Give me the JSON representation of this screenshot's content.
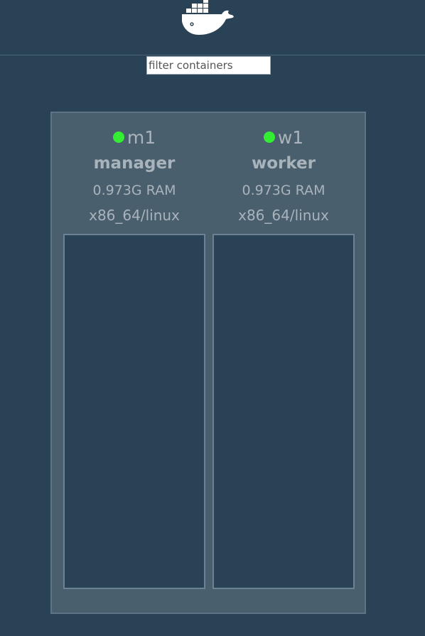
{
  "header": {
    "logo_icon": "docker-whale-icon"
  },
  "filter": {
    "placeholder": "filter containers",
    "value": ""
  },
  "colors": {
    "background": "#2a4256",
    "cluster_panel": "#4a5f6e",
    "status_ready": "#33ee33",
    "text_muted": "#a9b3bb"
  },
  "nodes": [
    {
      "name": "m1",
      "role": "manager",
      "ram": "0.973G RAM",
      "platform": "x86_64/linux",
      "status": "ready",
      "containers": []
    },
    {
      "name": "w1",
      "role": "worker",
      "ram": "0.973G RAM",
      "platform": "x86_64/linux",
      "status": "ready",
      "containers": []
    }
  ]
}
